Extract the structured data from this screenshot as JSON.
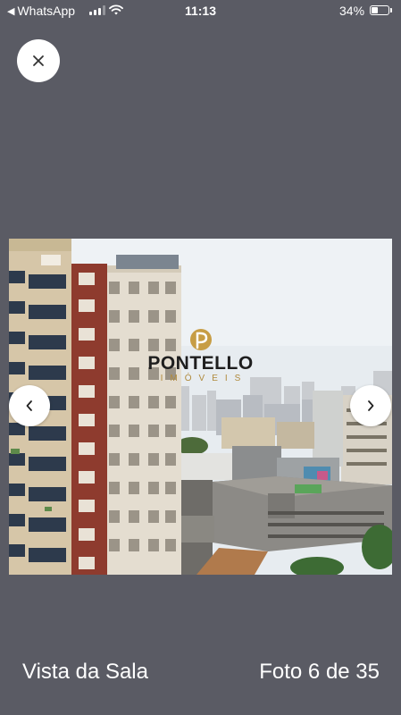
{
  "status_bar": {
    "back_app": "WhatsApp",
    "time": "11:13",
    "battery_percent": "34%",
    "battery_level": 0.34,
    "signal_bars": 3
  },
  "viewer": {
    "close_icon": "close-icon",
    "prev_icon": "chevron-left-icon",
    "next_icon": "chevron-right-icon",
    "watermark": {
      "brand": "PONTELLO",
      "subtitle": "IMÓVEIS"
    },
    "caption": "Vista da Sala",
    "counter": "Foto 6 de 35"
  },
  "colors": {
    "background": "#5a5b64",
    "accent_gold": "#b08a3c"
  }
}
